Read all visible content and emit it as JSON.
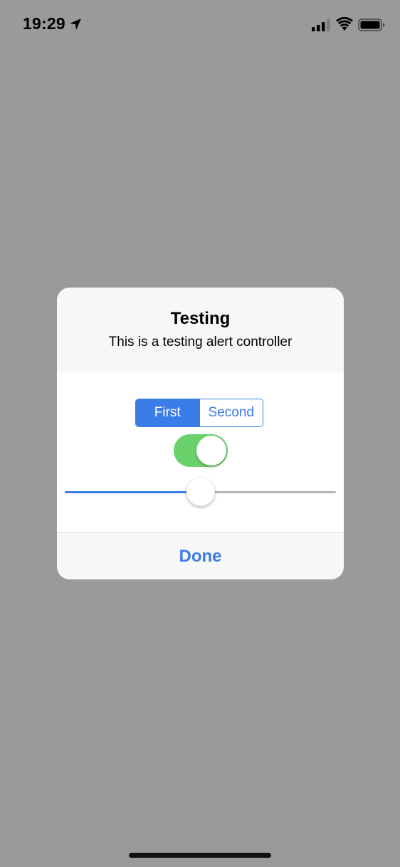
{
  "status_bar": {
    "time": "19:29",
    "icons": [
      "location-arrow-icon",
      "cellular-signal-icon",
      "wifi-icon",
      "battery-icon"
    ]
  },
  "alert": {
    "title": "Testing",
    "message": "This is a testing alert controller",
    "segmented_control": {
      "segments": [
        "First",
        "Second"
      ],
      "selected_index": 0
    },
    "toggle": {
      "on": true
    },
    "slider": {
      "value": 0.5
    },
    "done_label": "Done"
  },
  "colors": {
    "accent": "#3b7de8",
    "toggle_on": "#6bd26b",
    "dim_background": "#9a9a9a",
    "alert_background": "#f7f7f7"
  }
}
